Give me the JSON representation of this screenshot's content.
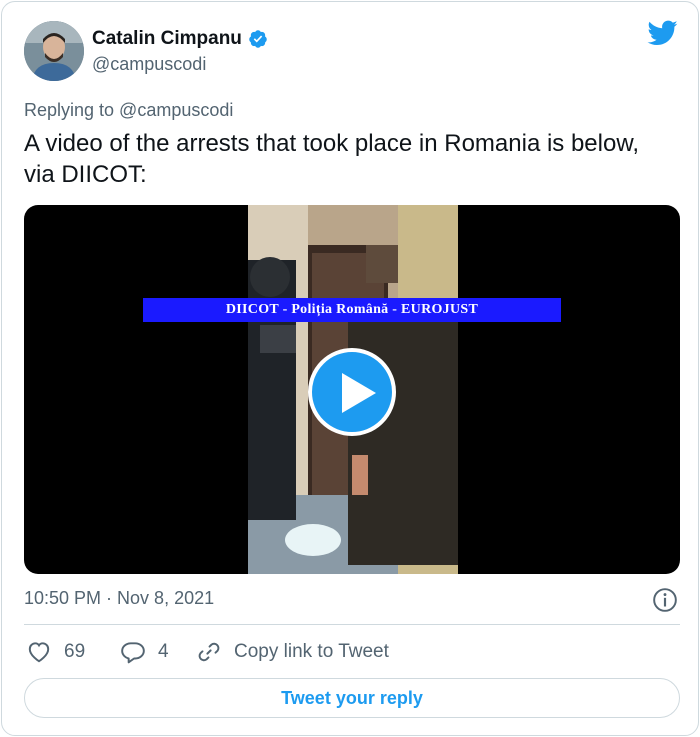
{
  "author": {
    "name": "Catalin Cimpanu",
    "handle": "@campuscodi"
  },
  "tweet": {
    "replying_to": "Replying to @campuscodi",
    "text": "A video of the arrests that took place in Romania is below, via DIICOT:"
  },
  "media": {
    "banner_text": "DIICOT - Poliția Română - EUROJUST",
    "play_icon": "play-icon"
  },
  "meta": {
    "timestamp": "10:50 PM · Nov 8, 2021"
  },
  "actions": {
    "like_count": "69",
    "reply_count": "4",
    "copy_link_label": "Copy link to Tweet",
    "reply_button_label": "Tweet your reply"
  },
  "colors": {
    "accent": "#1d9bf0",
    "text_primary": "#0f1419",
    "text_secondary": "#536471",
    "border": "#cfd9de",
    "banner_bg": "#1a1aff"
  }
}
